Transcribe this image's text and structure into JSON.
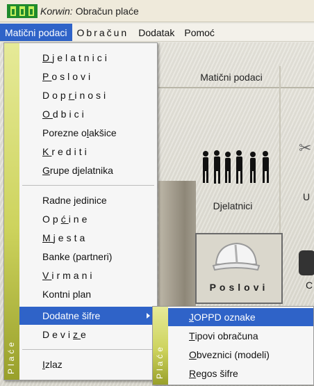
{
  "window": {
    "app_name": "Korwin:",
    "title": "Obračun plaće"
  },
  "menubar": {
    "items": [
      {
        "label": "Matični podaci",
        "active": true
      },
      {
        "label": "Obračun",
        "active": false
      },
      {
        "label": "Dodatak",
        "active": false
      },
      {
        "label": "Pomoć",
        "active": false
      }
    ]
  },
  "background": {
    "panel_header": "Matični podaci",
    "label_djelatnici": "Djelatnici",
    "label_poslovi": "Poslovi",
    "partial_label_u": "U",
    "partial_label_c": "C"
  },
  "dropdown": {
    "strip_text": "Plaće",
    "items": [
      {
        "pre": "",
        "u": "D",
        "post": "jelatnici"
      },
      {
        "pre": "",
        "u": "P",
        "post": "oslovi"
      },
      {
        "pre": "Dop",
        "u": "r",
        "post": "inosi"
      },
      {
        "pre": "",
        "u": "O",
        "post": "dbici"
      },
      {
        "pre": "Porezne o",
        "u": "l",
        "post": "akšice"
      },
      {
        "pre": "",
        "u": "K",
        "post": "rediti"
      },
      {
        "pre": "",
        "u": "G",
        "post": "rupe djelatnika"
      },
      {
        "pre": "Radne jedinice",
        "u": "",
        "post": ""
      },
      {
        "pre": "Op",
        "u": "ć",
        "post": "ine"
      },
      {
        "pre": "",
        "u": "M",
        "post": "jesta"
      },
      {
        "pre": "Banke (partneri)",
        "u": "",
        "post": ""
      },
      {
        "pre": "",
        "u": "V",
        "post": "irmani"
      },
      {
        "pre": "Kontni plan",
        "u": "",
        "post": ""
      },
      {
        "pre": "Dodatne šifre",
        "u": "",
        "post": ""
      },
      {
        "pre": "Devi",
        "u": "z",
        "post": "e"
      },
      {
        "pre": "",
        "u": "I",
        "post": "zlaz"
      }
    ]
  },
  "submenu": {
    "strip_text": "Plaće",
    "items": [
      {
        "pre": "",
        "u": "J",
        "post": "OPPD oznake"
      },
      {
        "pre": "",
        "u": "T",
        "post": "ipovi obračuna"
      },
      {
        "pre": "",
        "u": "O",
        "post": "bveznici (modeli)"
      },
      {
        "pre": "",
        "u": "R",
        "post": "egos šifre"
      }
    ]
  },
  "colors": {
    "highlight": "#2f63c8",
    "strip_top": "#e6ea98",
    "strip_bottom": "#99a02b"
  }
}
